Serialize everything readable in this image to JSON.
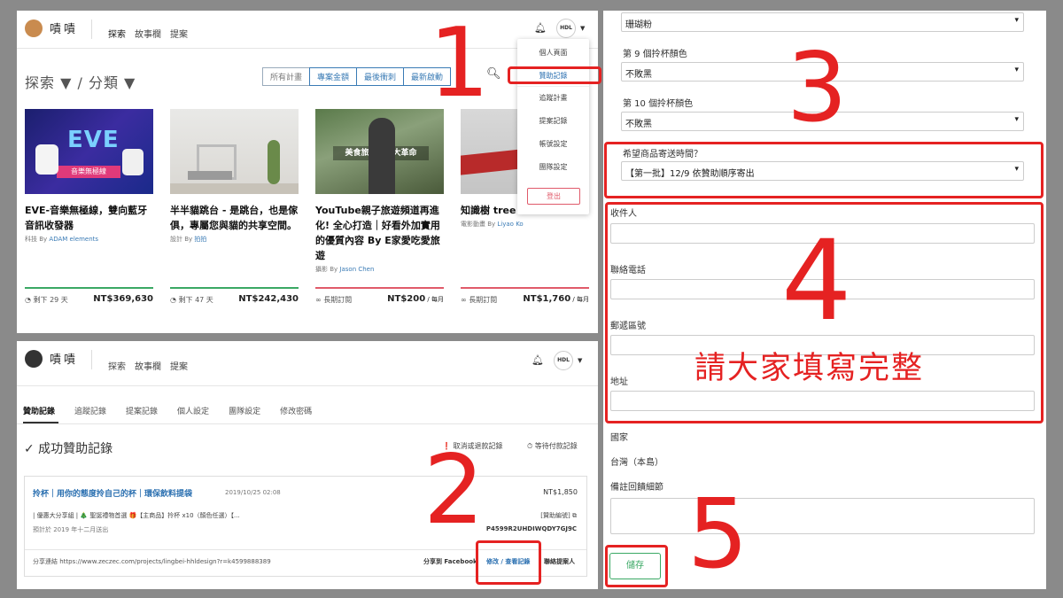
{
  "brand": "嘖嘖",
  "nav": [
    "探索",
    "故事欄",
    "提案"
  ],
  "avatar_text": "HDL",
  "explore": {
    "heading": "探索 ▼ / 分類 ▼"
  },
  "sort_tabs": [
    "所有計畫",
    "專案金額",
    "最後衝刺",
    "最新啟動"
  ],
  "cards": [
    {
      "thumb_text": "EVE",
      "thumb_sub": "音樂無極線",
      "title": "EVE-音樂無極線，雙向藍牙音訊收發器",
      "category": "科技 By",
      "creator": "ADAM elements",
      "remaining": "剩下 29 天",
      "amount": "NT$369,630",
      "unit": ""
    },
    {
      "thumb_text": "",
      "thumb_sub": "",
      "title": "半半貓跳台 - 是跳台，也是傢俱，專屬您與貓的共享空間。",
      "category": "設計 By",
      "creator": "拍拍",
      "remaining": "剩下 47 天",
      "amount": "NT$242,430",
      "unit": ""
    },
    {
      "thumb_text": "美食旅遊影片大革命",
      "thumb_sub": "",
      "title": "YouTube親子旅遊頻道再進化! 全心打造｜好看外加實用的優質內容 By E家愛吃愛旅遊",
      "category": "攝影 By",
      "creator": "Jason Chen",
      "remaining": "長期訂閱",
      "amount": "NT$200",
      "unit": " / 每月"
    },
    {
      "thumb_text": "",
      "thumb_sub": "",
      "title": "知識樹 tree ·",
      "category": "電影動畫 By",
      "creator": "Liyao Ko",
      "remaining": "長期訂閱",
      "amount": "NT$1,760",
      "unit": " / 每月"
    }
  ],
  "dropdown": [
    "個人頁面",
    "贊助記錄",
    "追蹤計畫",
    "提案記錄",
    "帳號設定",
    "團隊設定"
  ],
  "logout": "登出",
  "step_numbers": [
    "1",
    "2",
    "3",
    "4",
    "5"
  ],
  "panel2": {
    "tabs": [
      "贊助記錄",
      "追蹤記錄",
      "提案記錄",
      "個人設定",
      "團隊設定",
      "修改密碼"
    ],
    "heading": "✓ 成功贊助記錄",
    "actions": [
      "取消或退款記錄",
      "等待付款記錄"
    ],
    "record": {
      "title": "拎杯｜用你的態度拎自己的杯｜環保飲料提袋",
      "date": "2019/10/25 02:08",
      "price": "NT$1,850",
      "detail": "| 優惠大分享組 | 🎄 聖誕禮物首選 🎁【主商品】拎杯 x10（顏色任選）【...",
      "estimate": "預計於 2019 年十二月送出",
      "id_label": "[贊助編號]",
      "id": "P4599R2UHDIWQDY7GJ9C",
      "share": "分享連結 https://www.zeczec.com/projects/lingbei-hhldesign?r=k4599888389",
      "share_fb": "分享到 Facebook",
      "edit": "修改 / 查看記錄",
      "contact": "聯絡提案人"
    }
  },
  "panel3": {
    "top_value": "珊瑚粉",
    "fields": [
      {
        "label": "第 9 個拎杯顏色",
        "value": "不敗黑"
      },
      {
        "label": "第 10 個拎杯顏色",
        "value": "不敗黑"
      },
      {
        "label": "希望商品寄送時間？",
        "value": "【第一批】12/9 依贊助順序寄出"
      }
    ],
    "inputs": [
      "收件人",
      "聯絡電話",
      "郵遞區號",
      "地址"
    ],
    "country_label": "國家",
    "country_value": "台灣（本島）",
    "note_label": "備註回饋細節",
    "save": "儲存",
    "annotation": "請大家填寫完整"
  },
  "colors": {
    "accent": "#e52222",
    "link": "#2a6fb0",
    "save": "#3aa864"
  }
}
